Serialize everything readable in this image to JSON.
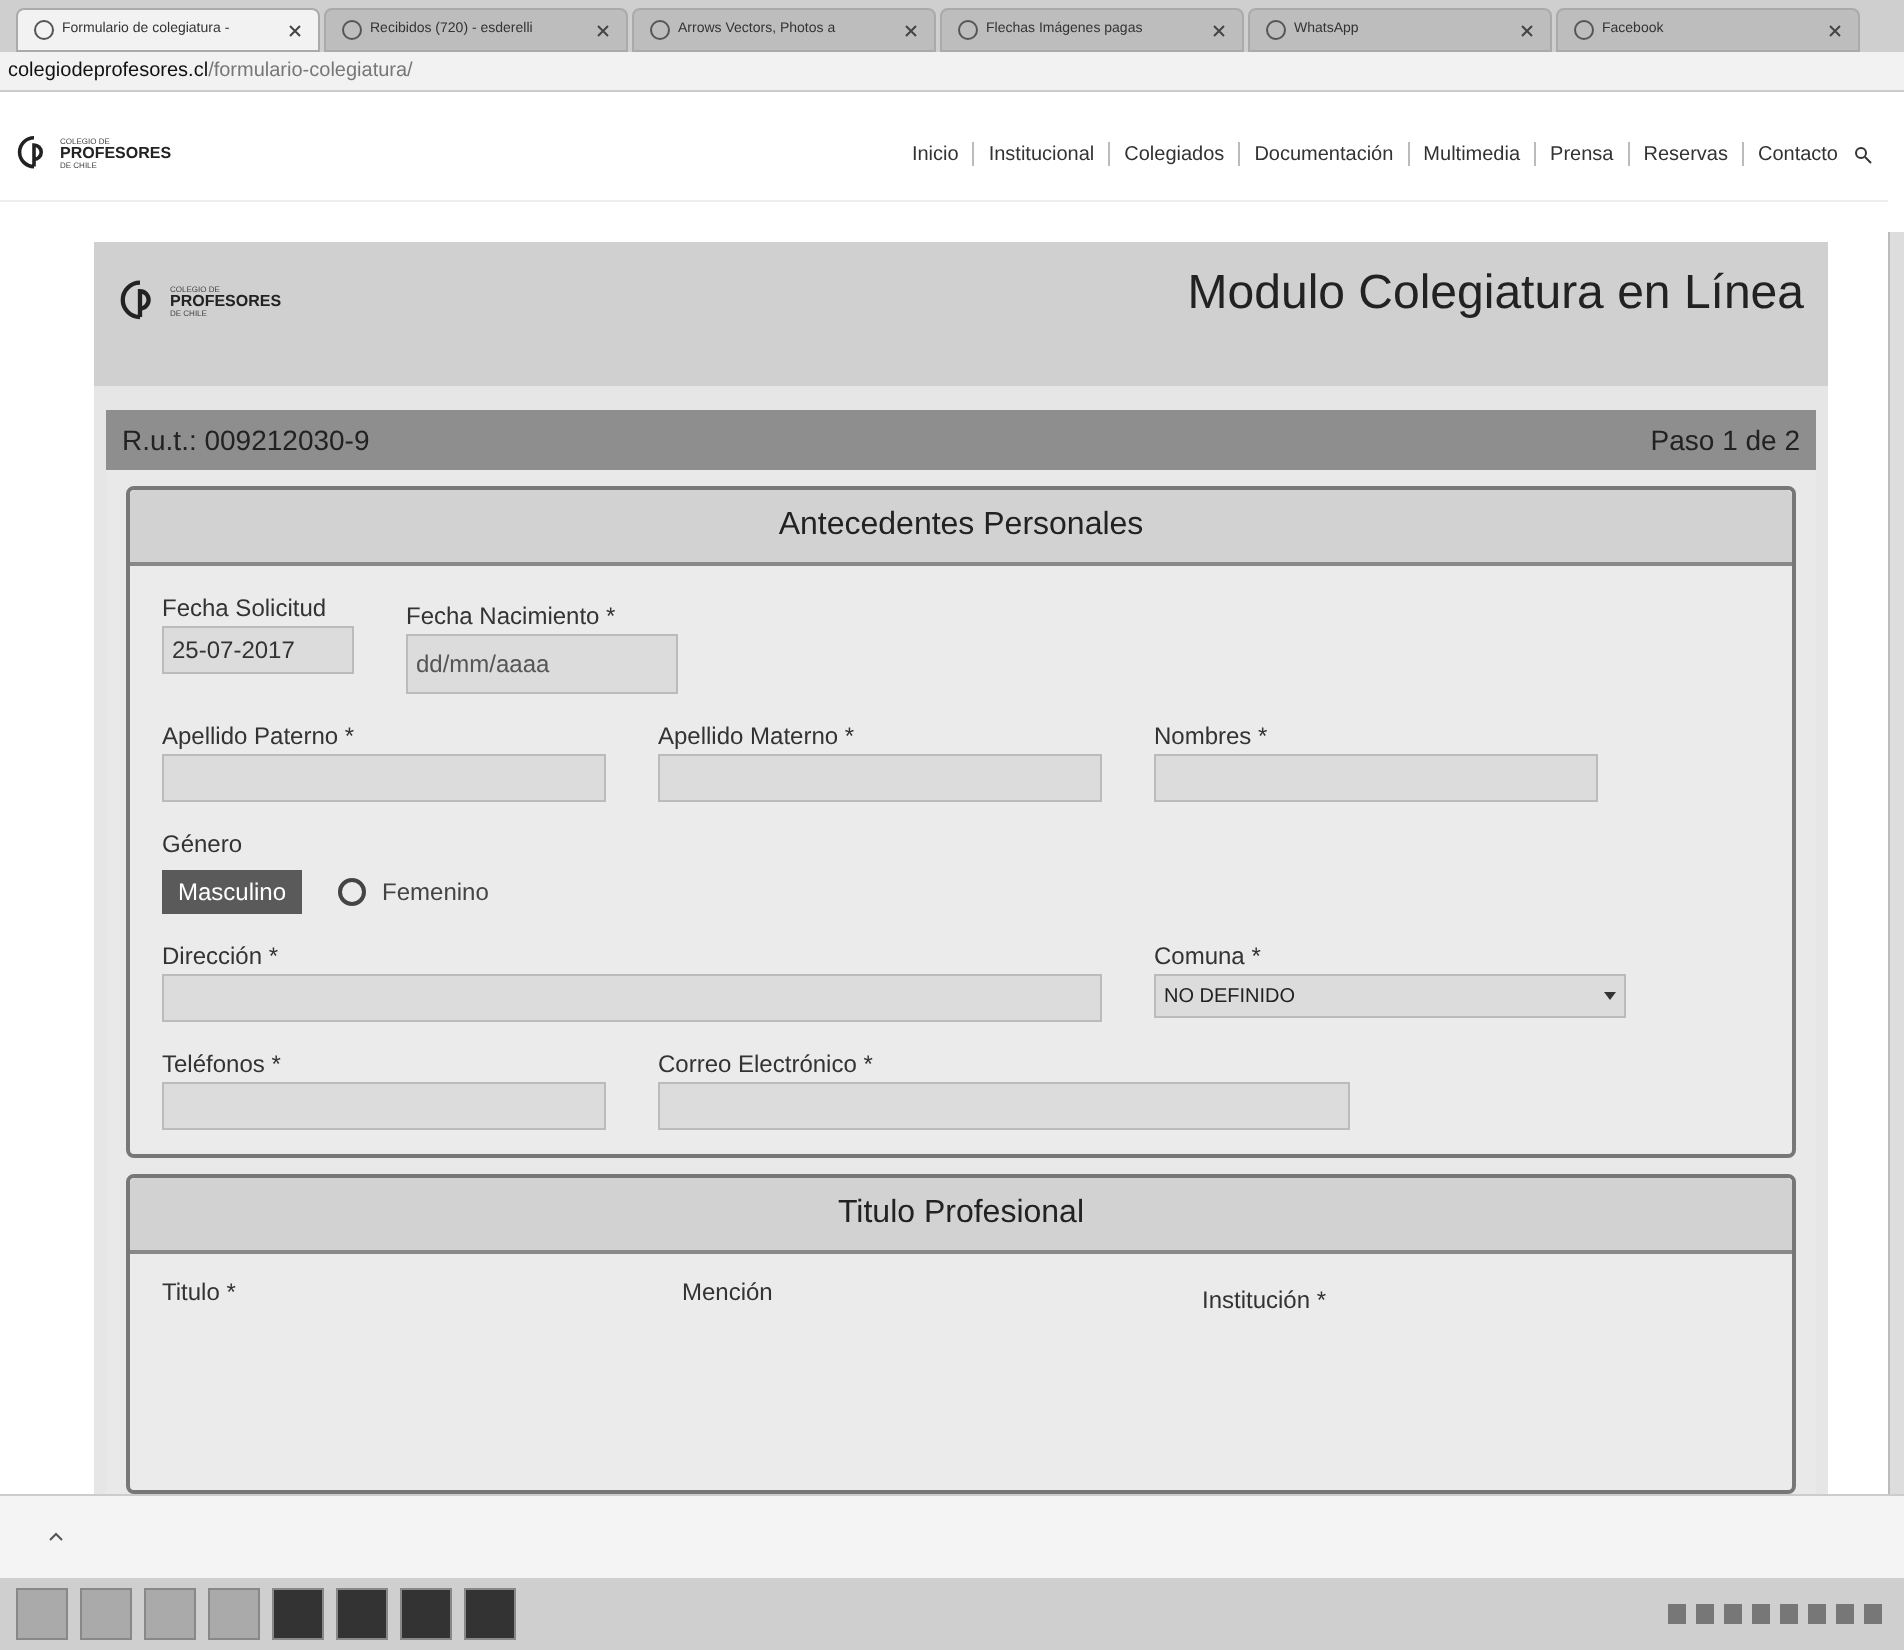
{
  "browser": {
    "tabs": [
      {
        "label": "Formulario de colegiatura -",
        "selected": true
      },
      {
        "label": "Recibidos (720) - esderelli",
        "selected": false
      },
      {
        "label": "Arrows Vectors, Photos a",
        "selected": false
      },
      {
        "label": "Flechas Imágenes pagas",
        "selected": false
      },
      {
        "label": "WhatsApp",
        "selected": false
      },
      {
        "label": "Facebook",
        "selected": false
      }
    ],
    "address": {
      "host": "colegiodeprofesores.cl",
      "path": "/formulario-colegiatura/"
    }
  },
  "site": {
    "logo": {
      "line_1": "COLEGIO DE",
      "line_2": "PROFESORES",
      "line_3": "DE CHILE"
    },
    "module_logo": {
      "line_1": "COLEGIO DE",
      "line_2": "PROFESORES",
      "line_3": "DE CHILE"
    },
    "nav": [
      "Inicio",
      "Institucional",
      "Colegiados",
      "Documentación",
      "Multimedia",
      "Prensa",
      "Reservas",
      "Contacto"
    ]
  },
  "module": {
    "title": "Modulo Colegiatura en Línea",
    "rut": "R.u.t.: 009212030-9",
    "step": "Paso 1 de 2"
  },
  "personal": {
    "heading": "Antecedentes Personales",
    "fecha_solicitud": {
      "label": "Fecha Solicitud",
      "value": "25-07-2017"
    },
    "fecha_nacimiento": {
      "label": "Fecha Nacimiento *",
      "placeholder": "dd/mm/aaaa"
    },
    "row_names": [
      {
        "label": "Apellido Paterno *"
      },
      {
        "label": "Apellido Materno *"
      },
      {
        "label": "Nombres *"
      }
    ],
    "genero": {
      "label": "Género",
      "options": [
        {
          "label": "Masculino",
          "selected": true
        },
        {
          "label": "Femenino",
          "selected": false
        }
      ]
    },
    "direccion": {
      "label": "Dirección *"
    },
    "comuna": {
      "label": "Comuna *",
      "value": "NO DEFINIDO"
    },
    "telefonos": {
      "label": "Teléfonos *"
    },
    "correo": {
      "label": "Correo Electrónico *"
    }
  },
  "titulo": {
    "heading": "Titulo Profesional",
    "labels": [
      "Titulo *",
      "Mención",
      "Institución *"
    ]
  }
}
